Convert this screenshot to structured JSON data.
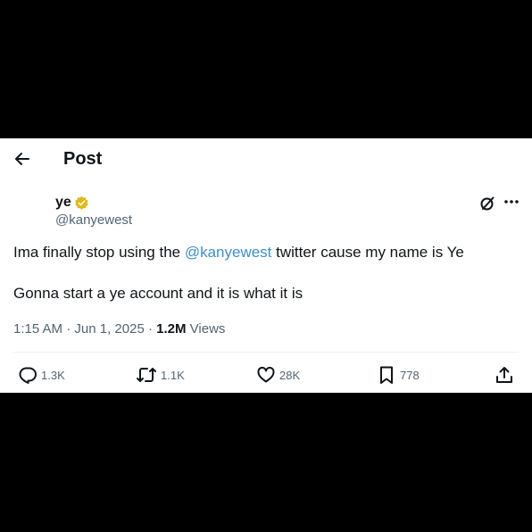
{
  "header": {
    "title": "Post"
  },
  "author": {
    "display_name": "ye",
    "handle": "@kanyewest"
  },
  "tweet": {
    "line1_before": "Ima finally stop using the ",
    "line1_mention": "@kanyewest",
    "line1_after": " twitter cause my name is Ye",
    "line2": "Gonna start a ye account and it is what it is"
  },
  "meta": {
    "time": "1:15 AM",
    "separator": " · ",
    "date": "Jun 1, 2025",
    "views_count": "1.2M",
    "views_label": " Views"
  },
  "actions": {
    "replies": "1.3K",
    "reposts": "1.1K",
    "likes": "28K",
    "bookmarks": "778"
  },
  "colors": {
    "accent": "#3e8fc9",
    "verified_badge": "#e2b719",
    "text": "#0f1419",
    "secondary": "#536471"
  },
  "icons": [
    "back-arrow-icon",
    "verified-badge-icon",
    "grok-icon",
    "more-icon",
    "reply-icon",
    "repost-icon",
    "like-icon",
    "bookmark-icon",
    "share-icon"
  ]
}
